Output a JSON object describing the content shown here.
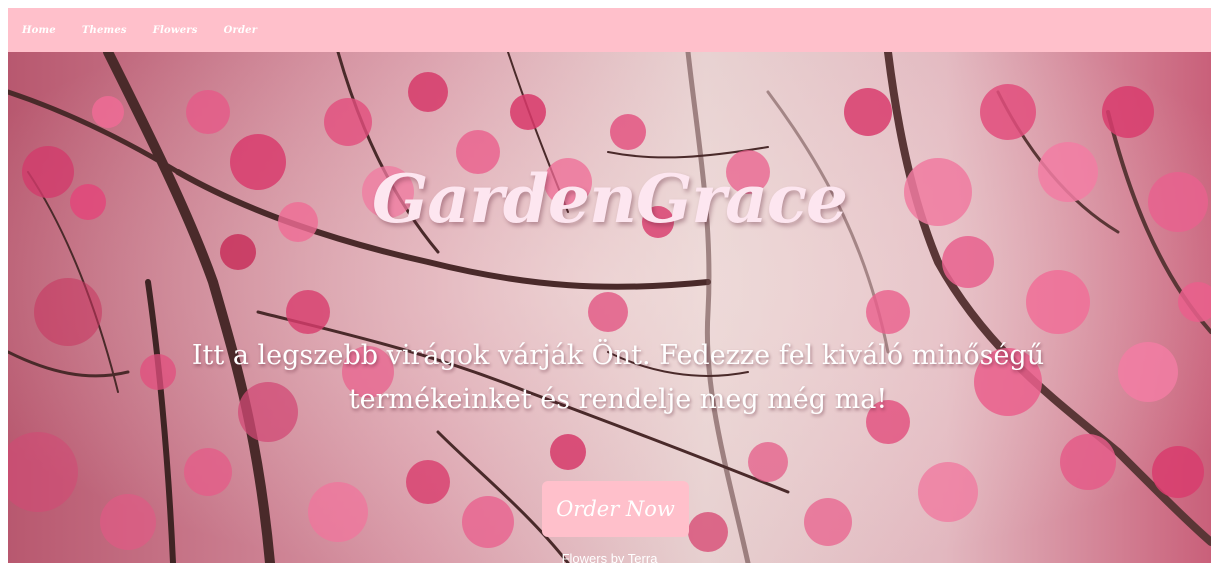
{
  "nav": {
    "items": [
      {
        "label": "Home"
      },
      {
        "label": "Themes"
      },
      {
        "label": "Flowers"
      },
      {
        "label": "Order"
      }
    ]
  },
  "hero": {
    "title": "GardenGrace",
    "tagline_line1": "Itt a legszebb virágok várják Önt. Fedezze fel kiváló minőségű",
    "tagline_line2": "termékeinket és rendelje meg még ma!",
    "cta_label": "Order Now",
    "footer_text": "Flowers by Terra"
  },
  "colors": {
    "nav_bg": "#ffc0cb",
    "button_bg": "#ffc0cb",
    "title_color": "#fde6f0",
    "text_color": "#ffffff"
  }
}
